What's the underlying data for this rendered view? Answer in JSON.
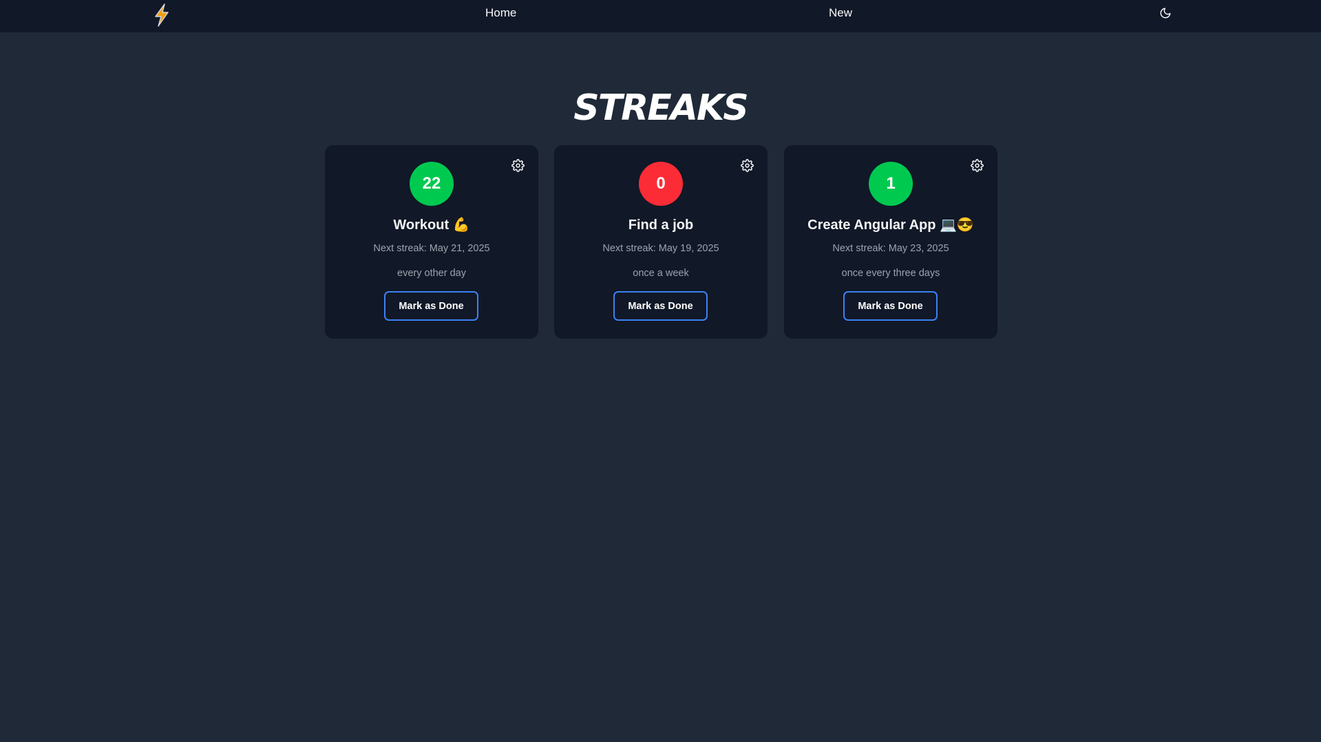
{
  "nav": {
    "logo_icon": "lightning-bolt-icon",
    "home_label": "Home",
    "new_label": "New",
    "theme_icon": "moon-icon"
  },
  "page": {
    "title": "STREAKS"
  },
  "colors": {
    "background": "#1f2937",
    "navbar": "#111827",
    "card": "#111827",
    "active_streak": "#00c950",
    "broken_streak": "#fb2c36",
    "button_border": "#3b82f6"
  },
  "streaks": [
    {
      "count": "22",
      "status_color": "#00c950",
      "name": "Workout 💪",
      "next_streak": "Next streak: May 21, 2025",
      "frequency": "every other day",
      "button_label": "Mark as Done",
      "settings_icon": "gear-icon"
    },
    {
      "count": "0",
      "status_color": "#fb2c36",
      "name": "Find a job",
      "next_streak": "Next streak: May 19, 2025",
      "frequency": "once a week",
      "button_label": "Mark as Done",
      "settings_icon": "gear-icon"
    },
    {
      "count": "1",
      "status_color": "#00c950",
      "name": "Create Angular App 💻😎",
      "next_streak": "Next streak: May 23, 2025",
      "frequency": "once every three days",
      "button_label": "Mark as Done",
      "settings_icon": "gear-icon"
    }
  ]
}
